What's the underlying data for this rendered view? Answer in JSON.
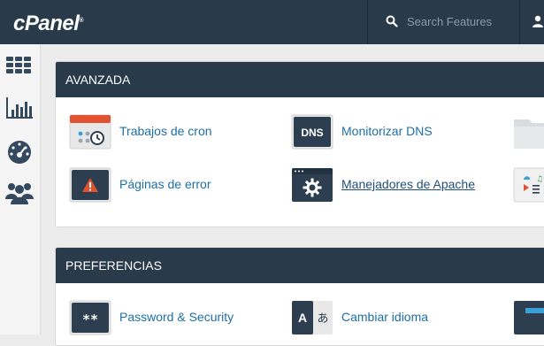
{
  "brand": {
    "logo_text": "cPanel",
    "trademark": "®"
  },
  "search": {
    "placeholder": "Search Features"
  },
  "sidebar": {
    "items": [
      {
        "icon": "grid-icon"
      },
      {
        "icon": "bar-chart-icon"
      },
      {
        "icon": "dashboard-gauge-icon"
      },
      {
        "icon": "users-icon"
      }
    ]
  },
  "sections": [
    {
      "title": "AVANZADA",
      "items": [
        {
          "label": "Trabajos de cron",
          "icon": "calendar-clock-icon"
        },
        {
          "label": "Monitorizar DNS",
          "icon": "dns-icon",
          "icon_text": "DNS"
        },
        {
          "label": "Páginas de error",
          "icon": "error-page-icon"
        },
        {
          "label": "Manejadores de Apache",
          "icon": "apache-handler-icon"
        }
      ]
    },
    {
      "title": "PREFERENCIAS",
      "items": [
        {
          "label": "Password & Security",
          "icon": "password-icon",
          "icon_text": "**"
        },
        {
          "label": "Cambiar idioma",
          "icon": "language-icon",
          "icon_text_a": "A",
          "icon_text_b": "あ"
        }
      ]
    }
  ],
  "colors": {
    "topbar": "#293a4a",
    "link": "#1d6fa5",
    "accent_orange": "#e0532e"
  }
}
